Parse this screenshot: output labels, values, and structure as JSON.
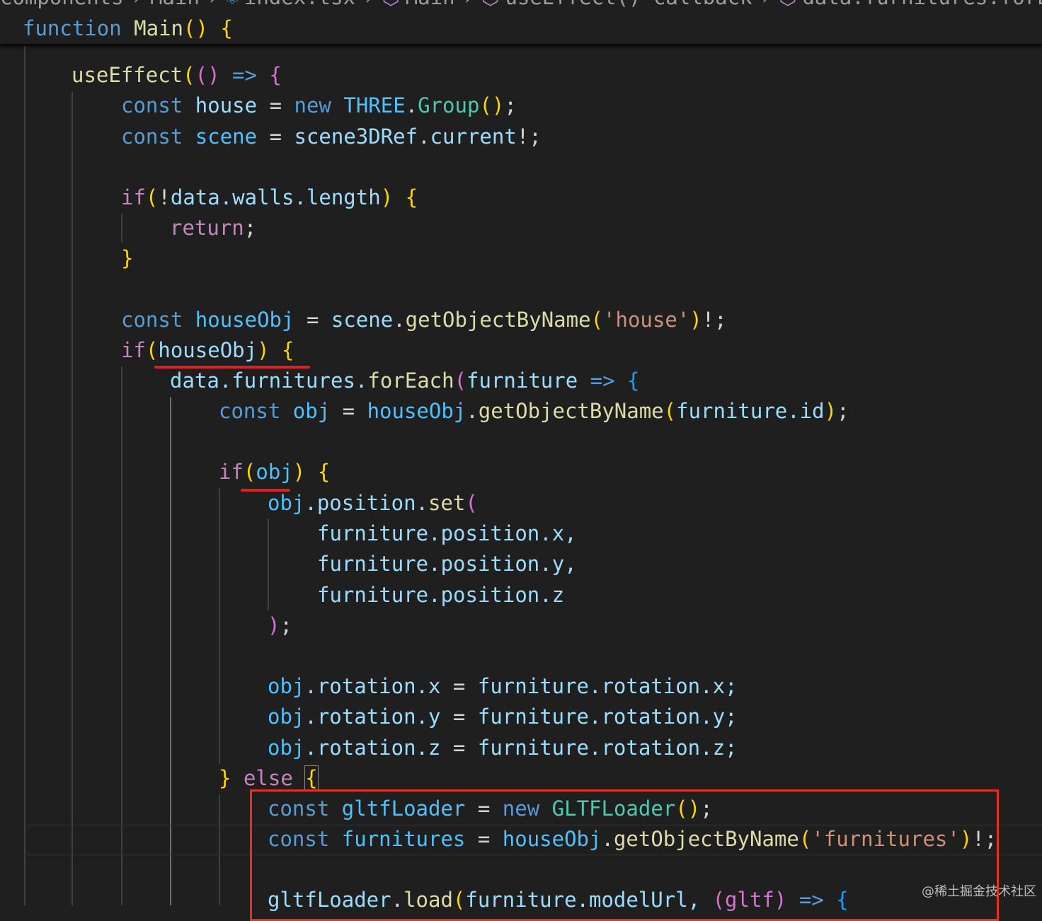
{
  "breadcrumb": {
    "items": [
      "components",
      "Main",
      "index.tsx",
      "Main",
      "useEffect() callback",
      "data.furnitures.forEach()"
    ]
  },
  "sticky_header": {
    "keyword": "function",
    "name": "Main",
    "parens": "()",
    "brace": "{"
  },
  "code": {
    "l1_fn": "useEffect",
    "l1_paren": "(",
    "l1_args": "()",
    "l1_arrow": "=>",
    "l1_brace": "{",
    "l2_const": "const",
    "l2_var": "house",
    "l2_eq": "=",
    "l2_new": "new",
    "l2_ns": "THREE",
    "l2_dot": ".",
    "l2_cls": "Group",
    "l2_call": "()",
    "l2_semi": ";",
    "l3_const": "const",
    "l3_var": "scene",
    "l3_eq": "=",
    "l3_ref": "scene3DRef",
    "l3_dot": ".",
    "l3_prop": "current",
    "l3_tail": "!;",
    "l4_if": "if",
    "l4_open": "(",
    "l4_not": "!",
    "l4_data": "data",
    "l4_walls": ".walls.length",
    "l4_close": ")",
    "l4_brace": "{",
    "l5_return": "return",
    "l5_semi": ";",
    "l6_brace": "}",
    "l7_const": "const",
    "l7_var": "houseObj",
    "l7_eq": "=",
    "l7_scene": "scene",
    "l7_dot": ".",
    "l7_fn": "getObjectByName",
    "l7_open": "(",
    "l7_str": "'house'",
    "l7_close": ")",
    "l7_tail": "!;",
    "l8_if": "if",
    "l8_open": "(",
    "l8_var": "houseObj",
    "l8_close": ")",
    "l8_brace": "{",
    "l9_data": "data",
    "l9_furn": ".furnitures.",
    "l9_fn": "forEach",
    "l9_open": "(",
    "l9_param": "furniture",
    "l9_arrow": "=>",
    "l9_brace": "{",
    "l10_const": "const",
    "l10_var": "obj",
    "l10_eq": "=",
    "l10_house": "houseObj",
    "l10_dot": ".",
    "l10_fn": "getObjectByName",
    "l10_open": "(",
    "l10_arg": "furniture.id",
    "l10_close": ")",
    "l10_semi": ";",
    "l11_if": "if",
    "l11_open": "(",
    "l11_var": "obj",
    "l11_close": ")",
    "l11_brace": "{",
    "l12_obj": "obj",
    "l12_prop": ".position.",
    "l12_fn": "set",
    "l12_open": "(",
    "l13": "furniture.position.x,",
    "l14": "furniture.position.y,",
    "l15": "furniture.position.z",
    "l16_close": ")",
    "l16_semi": ";",
    "l17_lhs": "obj",
    "l17_prop": ".rotation.x",
    "l17_eq": "=",
    "l17_rhs": "furniture.rotation.x;",
    "l18_lhs": "obj",
    "l18_prop": ".rotation.y",
    "l18_eq": "=",
    "l18_rhs": "furniture.rotation.y;",
    "l19_lhs": "obj",
    "l19_prop": ".rotation.z",
    "l19_eq": "=",
    "l19_rhs": "furniture.rotation.z;",
    "l20_close": "}",
    "l20_else": "else",
    "l20_brace": "{",
    "l21_const": "const",
    "l21_var": "gltfLoader",
    "l21_eq": "=",
    "l21_new": "new",
    "l21_cls": "GLTFLoader",
    "l21_call": "()",
    "l21_semi": ";",
    "l22_const": "const",
    "l22_var": "furnitures",
    "l22_eq": "=",
    "l22_house": "houseObj",
    "l22_dot": ".",
    "l22_fn": "getObjectByName",
    "l22_open": "(",
    "l22_str": "'furnitures'",
    "l22_close": ")",
    "l22_tail": "!;",
    "l23_obj": "gltfLoader",
    "l23_dot": ".",
    "l23_fn": "load",
    "l23_open": "(",
    "l23_arg": "furniture.modelUrl,",
    "l23_p": "(gltf)",
    "l23_arrow": "=>",
    "l23_brace": "{"
  },
  "watermark": "@稀土掘金技术社区",
  "colors": {
    "background": "#1f1f1f",
    "annotation_red": "#e53025"
  }
}
